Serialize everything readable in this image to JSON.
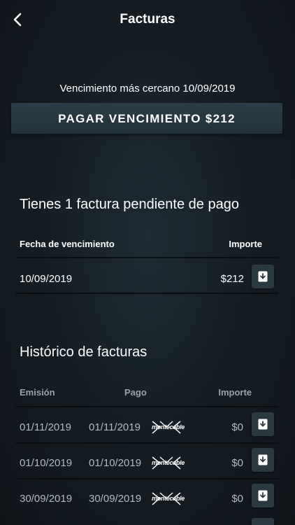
{
  "header": {
    "title": "Facturas",
    "back_icon": "chevron-left-icon"
  },
  "due": {
    "note": "Vencimiento más cercano 10/09/2019"
  },
  "pay_button": {
    "label": "PAGAR VENCIMIENTO $212"
  },
  "pending": {
    "title": "Tienes 1 factura pendiente de pago",
    "col_due": "Fecha de vencimiento",
    "col_amount": "Importe",
    "rows": [
      {
        "date": "10/09/2019",
        "amount": "$212",
        "icon": "download-icon"
      }
    ]
  },
  "history": {
    "title": "Histórico de facturas",
    "col_issue": "Emisión",
    "col_payment": "Pago",
    "col_amount": "Importe",
    "rows": [
      {
        "issue": "01/11/2019",
        "payment": "01/11/2019",
        "provider": "montecable",
        "amount": "$0"
      },
      {
        "issue": "01/10/2019",
        "payment": "01/10/2019",
        "provider": "montecable",
        "amount": "$0"
      },
      {
        "issue": "30/09/2019",
        "payment": "30/09/2019",
        "provider": "montecable",
        "amount": "$0"
      }
    ]
  }
}
